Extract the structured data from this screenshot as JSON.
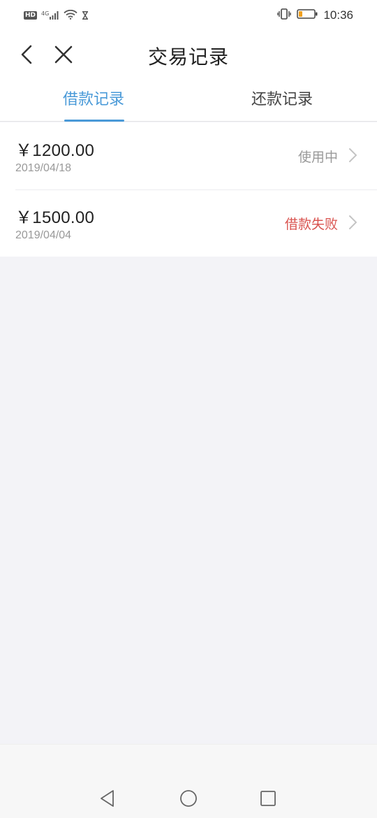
{
  "status_bar": {
    "network_label": "HD",
    "signal_label": "4G",
    "time": "10:36",
    "icons": [
      "hd-icon",
      "signal-icon",
      "wifi-icon",
      "hourglass-icon",
      "vibrate-icon",
      "battery-icon"
    ],
    "battery_color": "#f0a020"
  },
  "header": {
    "title": "交易记录",
    "back_icon": "chevron-left-icon",
    "close_icon": "close-icon"
  },
  "tabs": [
    {
      "label": "借款记录",
      "active": true
    },
    {
      "label": "还款记录",
      "active": false
    }
  ],
  "records": [
    {
      "amount": "￥1200.00",
      "date": "2019/04/18",
      "status": "使用中",
      "status_color": "#999999"
    },
    {
      "amount": "￥1500.00",
      "date": "2019/04/04",
      "status": "借款失败",
      "status_color": "#d9534f"
    }
  ],
  "nav_bar": {
    "icons": [
      "back-triangle-icon",
      "home-circle-icon",
      "recents-square-icon"
    ]
  },
  "colors": {
    "accent": "#4a9ad8",
    "background": "#f3f3f7"
  }
}
